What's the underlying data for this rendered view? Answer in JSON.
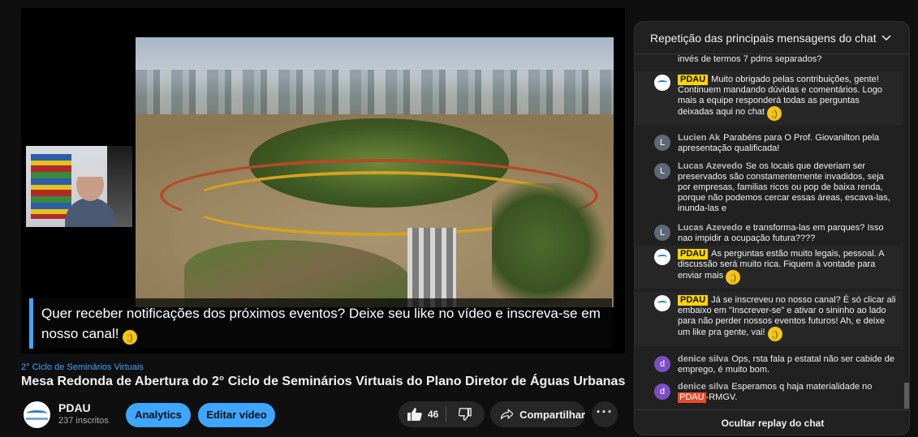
{
  "player": {
    "caption_text": "Quer receber notificações dos próximos eventos? Deixe seu like no vídeo e inscreva-se em nosso canal!",
    "caption_emoji": "wink-emoji"
  },
  "video": {
    "series": "2° Ciclo de Seminários Virtuais",
    "title": "Mesa Redonda de Abertura do 2° Ciclo de Seminários Virtuais do Plano Diretor de Águas Urbanas"
  },
  "channel": {
    "name": "PDAU",
    "subscribers": "237 inscritos"
  },
  "actions": {
    "analytics_label": "Analytics",
    "edit_label": "Editar vídeo",
    "like_count": "46",
    "share_label": "Compartilhar",
    "more_label": "···"
  },
  "colors": {
    "accent": "#3ea6ff",
    "owner_badge": "#ffd600",
    "mention": "#e94a2e"
  },
  "chat": {
    "header_title": "Repetição das principais mensagens do chat",
    "footer_label": "Ocultar replay do chat",
    "messages": [
      {
        "author": "",
        "text": "invés de termos 7 pdms separados?"
      },
      {
        "author": "PDAU",
        "text": "Muito obrigado pelas contribuições, gente! Continuem mandando dúvidas e comentários. Logo mais a equipe responderá todas as perguntas deixadas aqui no chat"
      },
      {
        "author": "Lucien Ak",
        "avatar": "L",
        "text": "Parabéns para O Prof. Giovanilton pela apresentação qualificada!"
      },
      {
        "author": "Lucas Azevedo",
        "avatar": "L",
        "text": "Se os locais que deveriam ser preservados são constamentemente invadidos, seja por empresas, familias ricos ou pop de baixa renda, porque não podemos cercar essas áreas, escava-las, inunda-las e"
      },
      {
        "author": "Lucas Azevedo",
        "avatar": "L",
        "text": "e transforma-las em parques? Isso nao impidir a ocupação futura????"
      },
      {
        "author": "PDAU",
        "text": "As perguntas estão muito legais, pessoal. A discussão será muito rica. Fiquem à vontade para enviar mais"
      },
      {
        "author": "PDAU",
        "text": "Já se inscreveu no nosso canal? É só clicar ali embaixo em \"Inscrever-se\" e ativar o sininho ao lado para não perder nossos eventos futuros! Ah, e deixe um like pra gente, vai!"
      },
      {
        "author": "denice silva",
        "avatar": "d",
        "text": "Ops, rsta fala p estatal não ser cabide de emprego, é muito bom."
      },
      {
        "author": "denice silva",
        "avatar": "d",
        "text": "Esperamos q haja materialidade no",
        "mention": "PDAU",
        "text_after": "-RMGV."
      }
    ]
  }
}
